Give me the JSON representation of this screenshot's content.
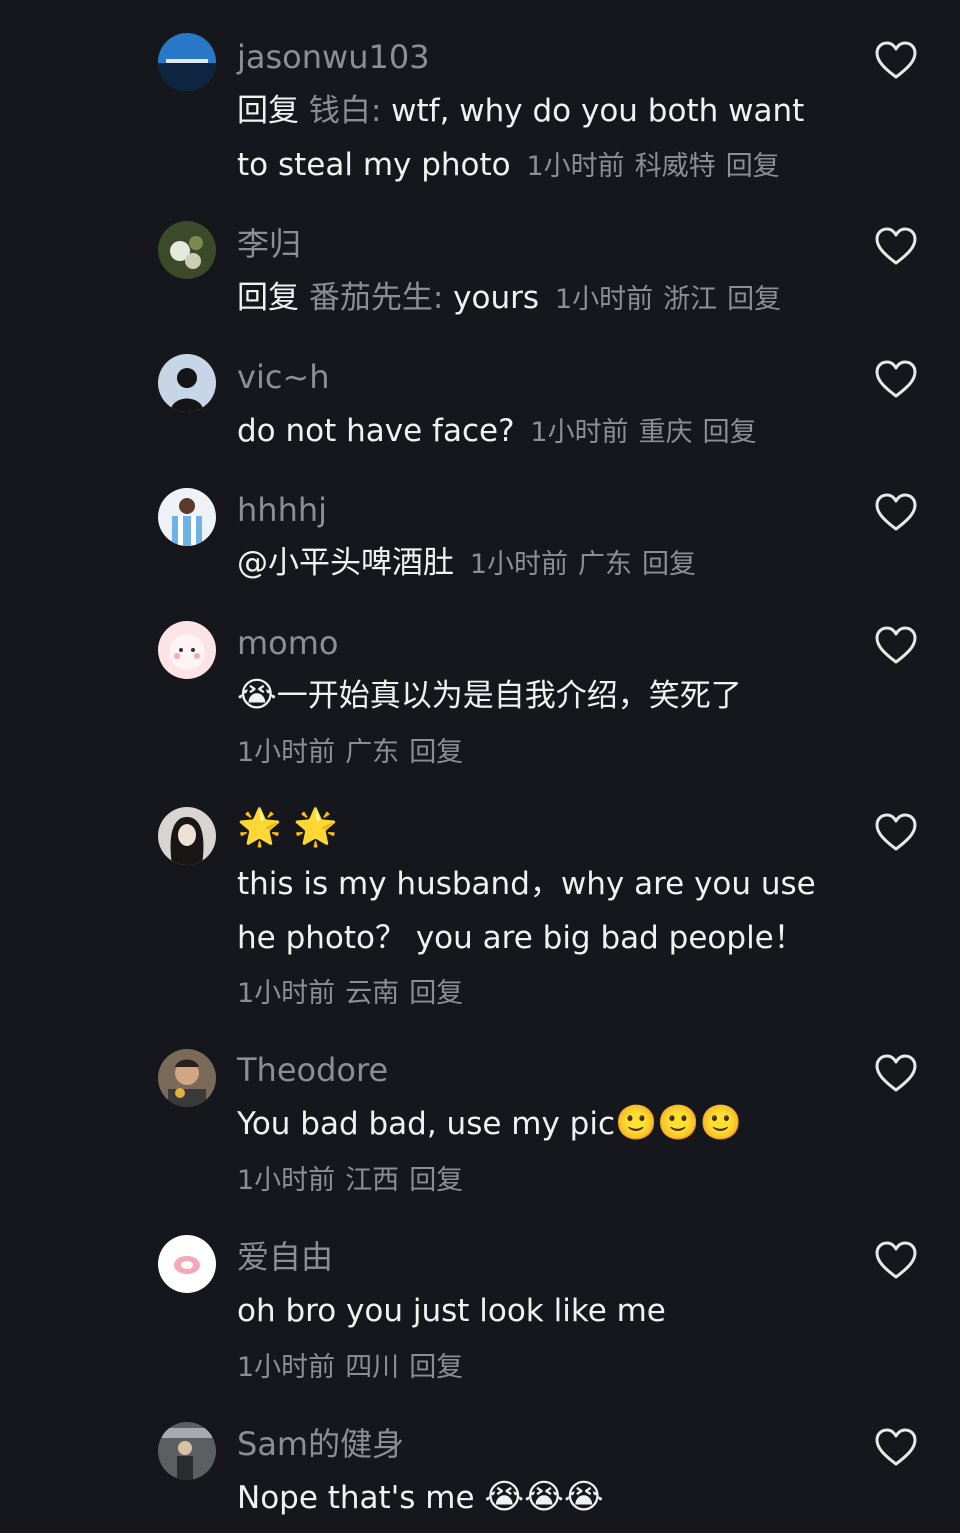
{
  "comments": [
    {
      "username": "jasonwu103",
      "reply_keyword": "回复",
      "reply_to": "钱白:",
      "text": " wtf, why do you both want to steal my photo",
      "time": "1小时前",
      "location": "科威特",
      "reply_label": "回复"
    },
    {
      "username": "李归",
      "reply_keyword": "回复",
      "reply_to": "番茄先生:",
      "text": " yours",
      "time": "1小时前",
      "location": "浙江",
      "reply_label": "回复"
    },
    {
      "username": "vic~h",
      "text": "do not have face?",
      "time": "1小时前",
      "location": "重庆",
      "reply_label": "回复"
    },
    {
      "username": "hhhhj",
      "text": "@小平头啤酒肚",
      "time": "1小时前",
      "location": "广东",
      "reply_label": "回复"
    },
    {
      "username": "momo",
      "emoji": "😭",
      "text": "一开始真以为是自我介绍，笑死了",
      "time": "1小时前",
      "location": "广东",
      "reply_label": "回复"
    },
    {
      "username": "🌟 🌟",
      "text": "this is my husband，why are you use he photo？ you are big bad people！",
      "time": "1小时前",
      "location": "云南",
      "reply_label": "回复"
    },
    {
      "username": "Theodore",
      "text": "You bad bad, use my pic",
      "emoji": "🙂🙂🙂",
      "time": "1小时前",
      "location": "江西",
      "reply_label": "回复"
    },
    {
      "username": "爱自由",
      "text": "oh bro you just look like me",
      "time": "1小时前",
      "location": "四川",
      "reply_label": "回复"
    },
    {
      "username": "Sam的健身",
      "text": "Nope that's me",
      "emoji": "😭😭😭",
      "time": "",
      "location": "",
      "reply_label": ""
    }
  ],
  "colors": {
    "background": "#16171c",
    "primary_text": "#f1f1f1",
    "secondary_text": "#8d8e94",
    "heart_outline": "#e8e8e8"
  },
  "icons": {
    "like": "heart-outline-icon"
  }
}
